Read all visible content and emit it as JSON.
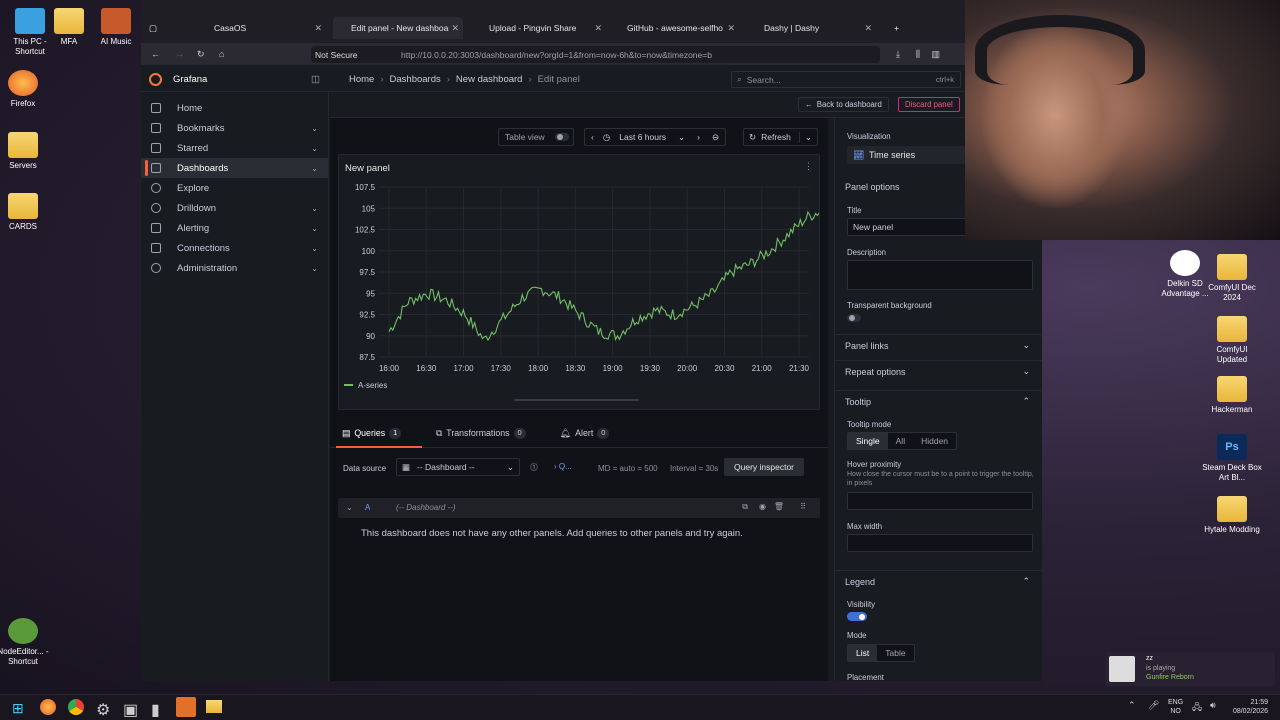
{
  "desktop": {
    "left_icons": [
      {
        "label": "This PC - Shortcut"
      },
      {
        "label": "Firefox"
      },
      {
        "label": "Servers"
      },
      {
        "label": "CARDS"
      },
      {
        "label": "NodeEditor... - Shortcut"
      }
    ],
    "top_icons": [
      {
        "label": "MFA"
      },
      {
        "label": "AI Music"
      }
    ],
    "right_icons": [
      {
        "label": "Delkin SD Advantage ..."
      },
      {
        "label": "ComfyUI Dec 2024"
      },
      {
        "label": "ComfyUI Updated"
      },
      {
        "label": "Hackerman"
      },
      {
        "label": "Steam Deck Box Art Bl..."
      },
      {
        "label": "Hytale Modding"
      }
    ]
  },
  "browser": {
    "tabs": [
      {
        "label": "CasaOS"
      },
      {
        "label": "Edit panel - New dashboard -"
      },
      {
        "label": "Upload - Pingvin Share"
      },
      {
        "label": "GitHub - awesome-selfhosted"
      },
      {
        "label": "Dashy | Dashy"
      }
    ],
    "security": "Not Secure",
    "url": "http://10.0.0.20:3003/dashboard/new?orgId=1&from=now-6h&to=now&timezone=b"
  },
  "grafana": {
    "brand": "Grafana",
    "breadcrumb": [
      "Home",
      "Dashboards",
      "New dashboard",
      "Edit panel"
    ],
    "search_placeholder": "Search...",
    "search_shortcut": "ctrl+k",
    "nav": [
      {
        "label": "Home"
      },
      {
        "label": "Bookmarks"
      },
      {
        "label": "Starred"
      },
      {
        "label": "Dashboards"
      },
      {
        "label": "Explore"
      },
      {
        "label": "Drilldown"
      },
      {
        "label": "Alerting"
      },
      {
        "label": "Connections"
      },
      {
        "label": "Administration"
      }
    ],
    "back_label": "Back to dashboard",
    "discard_label": "Discard panel",
    "table_view": "Table view",
    "time_range": "Last 6 hours",
    "refresh": "Refresh",
    "panel_title": "New panel",
    "tabs": [
      {
        "label": "Queries",
        "count": "1"
      },
      {
        "label": "Transformations",
        "count": "0"
      },
      {
        "label": "Alert",
        "count": "0"
      }
    ],
    "data_source_label": "Data source",
    "data_source_value": "-- Dashboard --",
    "query_meta": "MD = auto = 500",
    "interval": "Interval = 30s",
    "query_inspector": "Query inspector",
    "query_ref": "A",
    "query_ds": "(-- Dashboard --)",
    "query_message": "This dashboard does not have any other panels. Add queries to other panels and try again.",
    "options": {
      "visualization_label": "Visualization",
      "visualization_value": "Time series",
      "panel_options": "Panel options",
      "title_label": "Title",
      "title_value": "New panel",
      "description_label": "Description",
      "transparent_label": "Transparent background",
      "panel_links": "Panel links",
      "repeat_options": "Repeat options",
      "tooltip": "Tooltip",
      "tooltip_mode": "Tooltip mode",
      "tooltip_modes": [
        "Single",
        "All",
        "Hidden"
      ],
      "hover_proximity": "Hover proximity",
      "hover_help": "How close the cursor must be to a point to trigger the tooltip, in pixels",
      "max_width": "Max width",
      "legend": "Legend",
      "visibility": "Visibility",
      "mode": "Mode",
      "modes": [
        "List",
        "Table"
      ],
      "placement": "Placement"
    }
  },
  "notification": {
    "title": "zz",
    "line1": "is playing",
    "line2": "Gunfire Reborn"
  },
  "tray": {
    "lang1": "ENG",
    "lang2": "NO",
    "time": "21:59",
    "date": "08/02/2026"
  },
  "chart_data": {
    "type": "line",
    "series": [
      {
        "name": "A-series",
        "color": "#73bf69"
      }
    ],
    "x_ticks": [
      "16:00",
      "16:30",
      "17:00",
      "17:30",
      "18:00",
      "18:30",
      "19:00",
      "19:30",
      "20:00",
      "20:30",
      "21:00",
      "21:30"
    ],
    "y_ticks": [
      "107.5",
      "105",
      "102.5",
      "100",
      "97.5",
      "95",
      "92.5",
      "90",
      "87.5"
    ],
    "ylim": [
      87.5,
      107.5
    ],
    "grid": true,
    "legend": "bottom-left",
    "x": [
      "16:00",
      "16:15",
      "16:30",
      "16:45",
      "17:00",
      "17:15",
      "17:30",
      "17:45",
      "18:00",
      "18:15",
      "18:30",
      "18:45",
      "19:00",
      "19:15",
      "19:30",
      "19:45",
      "20:00",
      "20:15",
      "20:30",
      "20:45",
      "21:00",
      "21:15",
      "21:30",
      "21:45"
    ],
    "values": [
      90.5,
      94,
      95,
      94.2,
      92.5,
      89.5,
      92,
      94.5,
      95.5,
      94.5,
      92.5,
      90.5,
      90,
      92,
      93,
      92.5,
      93.5,
      95,
      97.5,
      98.5,
      100,
      102,
      104,
      105
    ]
  }
}
